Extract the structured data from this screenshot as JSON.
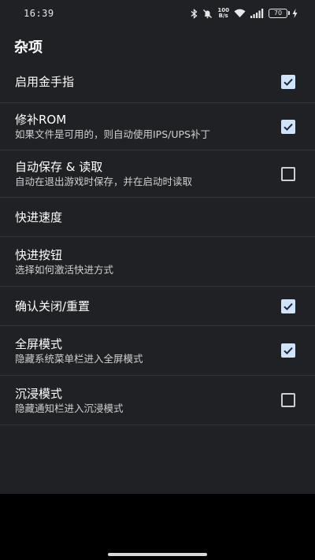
{
  "status_bar": {
    "time": "16:39",
    "net_speed_value": "100",
    "net_speed_unit": "B/s",
    "battery_level": "70",
    "icons": [
      "bluetooth-icon",
      "mute-icon",
      "net-speed-icon",
      "wifi-icon",
      "signal-icon",
      "battery-icon",
      "charging-icon"
    ]
  },
  "section": {
    "title": "杂项"
  },
  "settings": [
    {
      "title": "启用金手指",
      "description": "",
      "checkbox": "checked"
    },
    {
      "title": "修补ROM",
      "description": "如果文件是可用的，则自动使用IPS/UPS补丁",
      "checkbox": "checked"
    },
    {
      "title": "自动保存 & 读取",
      "description": "自动在退出游戏时保存，并在启动时读取",
      "checkbox": "unchecked"
    },
    {
      "title": "快进速度",
      "description": "",
      "checkbox": "none"
    },
    {
      "title": "快进按钮",
      "description": "选择如何激活快进方式",
      "checkbox": "none"
    },
    {
      "title": "确认关闭/重置",
      "description": "",
      "checkbox": "checked"
    },
    {
      "title": "全屏模式",
      "description": "隐藏系统菜单栏进入全屏模式",
      "checkbox": "checked"
    },
    {
      "title": "沉浸模式",
      "description": "隐藏通知栏进入沉浸模式",
      "checkbox": "unchecked"
    }
  ],
  "colors": {
    "background": "#202124",
    "checkbox_checked": "#cfe3fb",
    "checkmark": "#1f2a36",
    "divider": "#34363a"
  }
}
